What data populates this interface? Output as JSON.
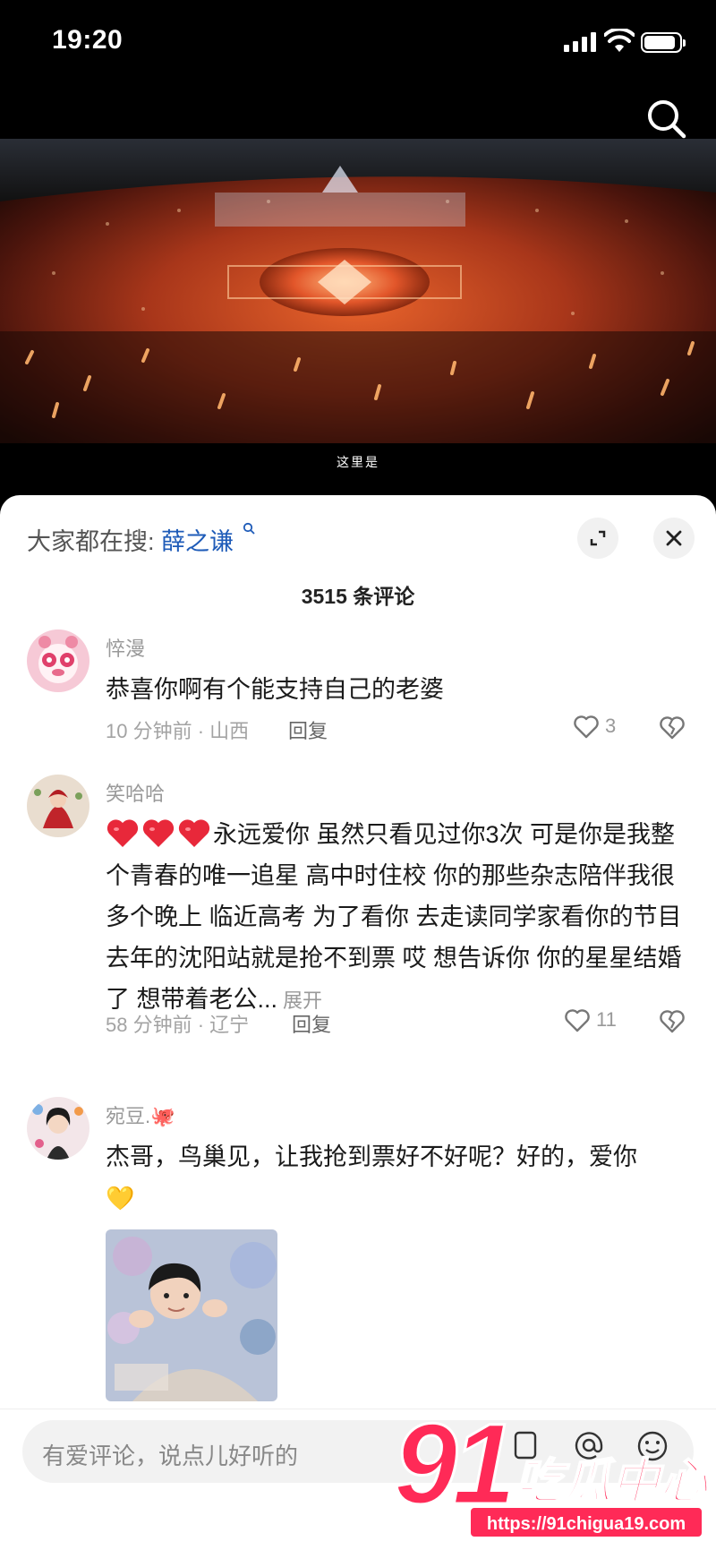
{
  "status_bar": {
    "time": "19:20"
  },
  "video": {
    "caption": "这里是"
  },
  "panel": {
    "hot_search_label": "大家都在搜:",
    "hot_search_term": "薛之谦",
    "comment_count": "3515 条评论"
  },
  "comments": [
    {
      "name": "悴漫",
      "text": "恭喜你啊有个能支持自己的老婆",
      "time_location": "10 分钟前 · 山西",
      "reply": "回复",
      "likes": "3"
    },
    {
      "name": "笑哈哈",
      "text": "永远爱你 虽然只看见过你3次 可是你是我整个青春的唯一追星 高中时住校 你的那些杂志陪伴我很多个晚上 临近高考 为了看你 去走读同学家看你的节目 去年的沈阳站就是抢不到票 哎 想告诉你 你的星星结婚了 想带着老公...",
      "more": "展开",
      "time_location": "58 分钟前 · 辽宁",
      "reply": "回复",
      "likes": "11"
    },
    {
      "name": "宛豆.🐙",
      "text": "杰哥，鸟巢见，让我抢到票好不好呢？好的，爱你",
      "emoji": "💛"
    }
  ],
  "input": {
    "placeholder": "有爱评论，说点儿好听的"
  },
  "watermark": {
    "big": "91",
    "cn": "吃瓜中心",
    "url": "https://91chigua19.com"
  },
  "icons": [
    "search-icon",
    "expand-icon",
    "close-icon",
    "heart-icon",
    "broken-heart-icon",
    "at-icon",
    "emoji-icon"
  ]
}
